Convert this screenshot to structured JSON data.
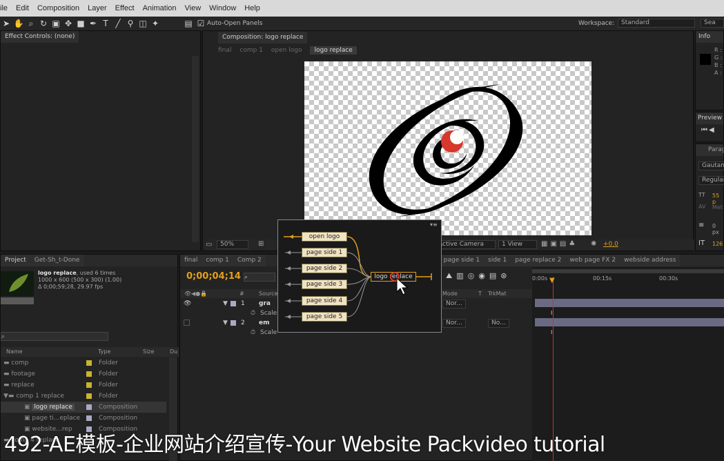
{
  "menu": [
    "ile",
    "Edit",
    "Composition",
    "Layer",
    "Effect",
    "Animation",
    "View",
    "Window",
    "Help"
  ],
  "toolbar": {
    "auto_open_label": "Auto-Open Panels",
    "workspace_label": "Workspace:",
    "workspace_value": "Standard",
    "search_placeholder": "Sea"
  },
  "effect_controls": {
    "tab": "Effect Controls: (none)"
  },
  "composition": {
    "tab": "Composition: logo replace",
    "breadcrumbs": [
      "final",
      "comp 1",
      "open logo",
      "logo replace"
    ],
    "zoom": "50%",
    "camera": "Active Camera",
    "view": "1 View",
    "exposure": "+0.0"
  },
  "info": {
    "tab": "Info",
    "channels": [
      "R :",
      "G :",
      "B :",
      "A :"
    ]
  },
  "preview": {
    "tab": "Preview"
  },
  "paragraph": {
    "tab": "Parag",
    "font": "Gautam",
    "style": "Regular",
    "size": "55 p",
    "metrics": "Met",
    "indent": "0 px",
    "leading": "126"
  },
  "project": {
    "tabs": [
      "Project",
      "Get-Sh_t-Done"
    ],
    "item_name": "logo replace",
    "used": ", used 6 times",
    "dims": "1000 x 600  (500 x 300) (1.00)",
    "duration": "Δ 0;00;59;28, 29.97 fps",
    "columns": [
      "Name",
      "Type",
      "Size",
      "Du"
    ],
    "rows": [
      {
        "name": "comp",
        "type": "Folder"
      },
      {
        "name": "footage",
        "type": "Folder"
      },
      {
        "name": "replace",
        "type": "Folder"
      },
      {
        "name": "comp 1 replace",
        "type": "Folder"
      },
      {
        "name": "logo replace",
        "type": "Composition"
      },
      {
        "name": "page ti...eplace",
        "type": "Composition"
      },
      {
        "name": "website...rep",
        "type": "Composition"
      },
      {
        "name": "comp 4 replace",
        "type": "Folder"
      }
    ]
  },
  "timeline": {
    "tabs": [
      "final",
      "comp 1",
      "Comp 2",
      "page side 1",
      "side 1",
      "page replace 2",
      "web page FX 2",
      "webside address"
    ],
    "timecode": "0;00;04;14",
    "columns": [
      "#",
      "Source Name",
      "Mode",
      "T",
      "TrkMat"
    ],
    "layers": [
      {
        "num": "1",
        "name": "gra",
        "mode": "Nor...",
        "prop": "Scale"
      },
      {
        "num": "2",
        "name": "em",
        "mode": "Nor...",
        "trkmat": "No...",
        "prop": "Scale"
      }
    ],
    "ruler": [
      "0:00s",
      "00:15s",
      "00:30s"
    ]
  },
  "flowchart": {
    "open_logo": "open logo",
    "target": "logo replace",
    "pages": [
      "page side 1",
      "page side 2",
      "page side 3",
      "page side 4",
      "page side 5"
    ]
  },
  "caption": "492-AE模板-企业网站介绍宣传-Your Website Packvideo tutorial",
  "colors": {
    "accent": "#e3a01b",
    "logo_red": "#d8382c",
    "playhead": "#c0392b"
  }
}
